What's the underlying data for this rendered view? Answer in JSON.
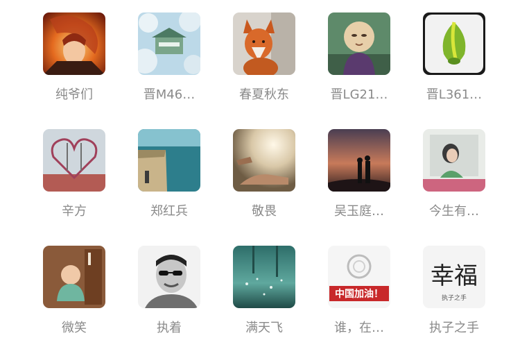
{
  "contacts": [
    {
      "name": "纯爷们",
      "avatar": "anime-character-avatar"
    },
    {
      "name": "晋M46…",
      "avatar": "snowy-house-avatar"
    },
    {
      "name": "春夏秋东",
      "avatar": "fox-avatar"
    },
    {
      "name": "晋LG21…",
      "avatar": "monk-figurine-avatar"
    },
    {
      "name": "晋L361…",
      "avatar": "green-leaf-logo-avatar"
    },
    {
      "name": "辛方",
      "avatar": "heart-sculpture-avatar"
    },
    {
      "name": "郑红兵",
      "avatar": "sea-cliff-avatar"
    },
    {
      "name": "敬畏",
      "avatar": "hands-light-avatar"
    },
    {
      "name": "吴玉庭…",
      "avatar": "sunset-couple-avatar"
    },
    {
      "name": "今生有…",
      "avatar": "girl-photo-avatar"
    },
    {
      "name": "微笑",
      "avatar": "baby-figurine-avatar"
    },
    {
      "name": "执着",
      "avatar": "man-sunglasses-avatar"
    },
    {
      "name": "满天飞",
      "avatar": "teal-forest-avatar"
    },
    {
      "name": "谁，在…",
      "avatar": "china-flag-text-avatar",
      "badge_text": "中国加油！"
    },
    {
      "name": "执子之手",
      "avatar": "calligraphy-avatar",
      "badge_text": "幸福",
      "sub_text": "执子之手"
    }
  ]
}
